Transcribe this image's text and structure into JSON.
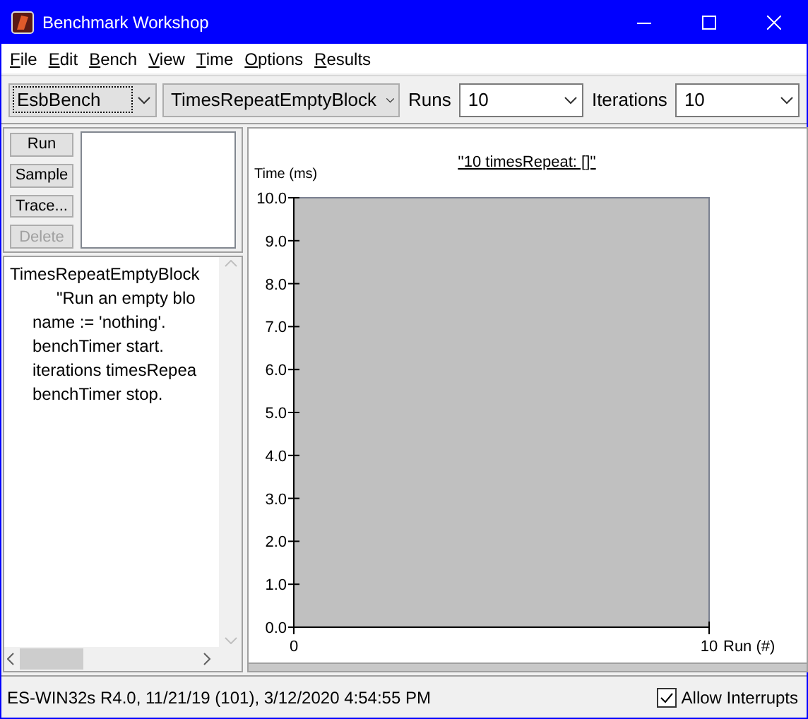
{
  "window": {
    "title": "Benchmark Workshop"
  },
  "menu": [
    "File",
    "Edit",
    "Bench",
    "View",
    "Time",
    "Options",
    "Results"
  ],
  "toolbar": {
    "suite": {
      "value": "EsbBench",
      "focused": true
    },
    "benchmark": {
      "value": "TimesRepeatEmptyBlock"
    },
    "runs": {
      "label": "Runs",
      "value": "10"
    },
    "iterations": {
      "label": "Iterations",
      "value": "10"
    }
  },
  "actions": [
    {
      "label": "Run",
      "disabled": false
    },
    {
      "label": "Sample",
      "disabled": false
    },
    {
      "label": "Trace...",
      "disabled": false
    },
    {
      "label": "Delete",
      "disabled": true
    }
  ],
  "source": [
    {
      "kind": "header",
      "text": "TimesRepeatEmptyBlock"
    },
    {
      "kind": "comment",
      "text": "\"Run an empty blo"
    },
    {
      "kind": "statement",
      "text": "name := 'nothing'."
    },
    {
      "kind": "statement",
      "text": "benchTimer start."
    },
    {
      "kind": "statement",
      "text": "iterations timesRepea"
    },
    {
      "kind": "statement",
      "text": "benchTimer stop."
    }
  ],
  "chart_data": {
    "type": "bar",
    "title": "''10 timesRepeat: []''",
    "xlabel": "Run (#)",
    "ylabel": "Time (ms)",
    "xlim": [
      0,
      10
    ],
    "ylim": [
      0,
      10
    ],
    "xticks": [
      0,
      10
    ],
    "yticks": [
      {
        "value": 0,
        "label": "0.0"
      },
      {
        "value": 1,
        "label": "1.0"
      },
      {
        "value": 2,
        "label": "2.0"
      },
      {
        "value": 3,
        "label": "3.0"
      },
      {
        "value": 4,
        "label": "4.0"
      },
      {
        "value": 5,
        "label": "5.0"
      },
      {
        "value": 6,
        "label": "6.0"
      },
      {
        "value": 7,
        "label": "7.0"
      },
      {
        "value": 8,
        "label": "8.0"
      },
      {
        "value": 9,
        "label": "9.0"
      },
      {
        "value": 10,
        "label": "10.0"
      }
    ]
  },
  "status_bar": {
    "text": "ES-WIN32s R4.0, 11/21/19 (101), 3/12/2020 4:54:55 PM",
    "allow_interrupts": {
      "label": "Allow Interrupts",
      "checked": true
    }
  }
}
